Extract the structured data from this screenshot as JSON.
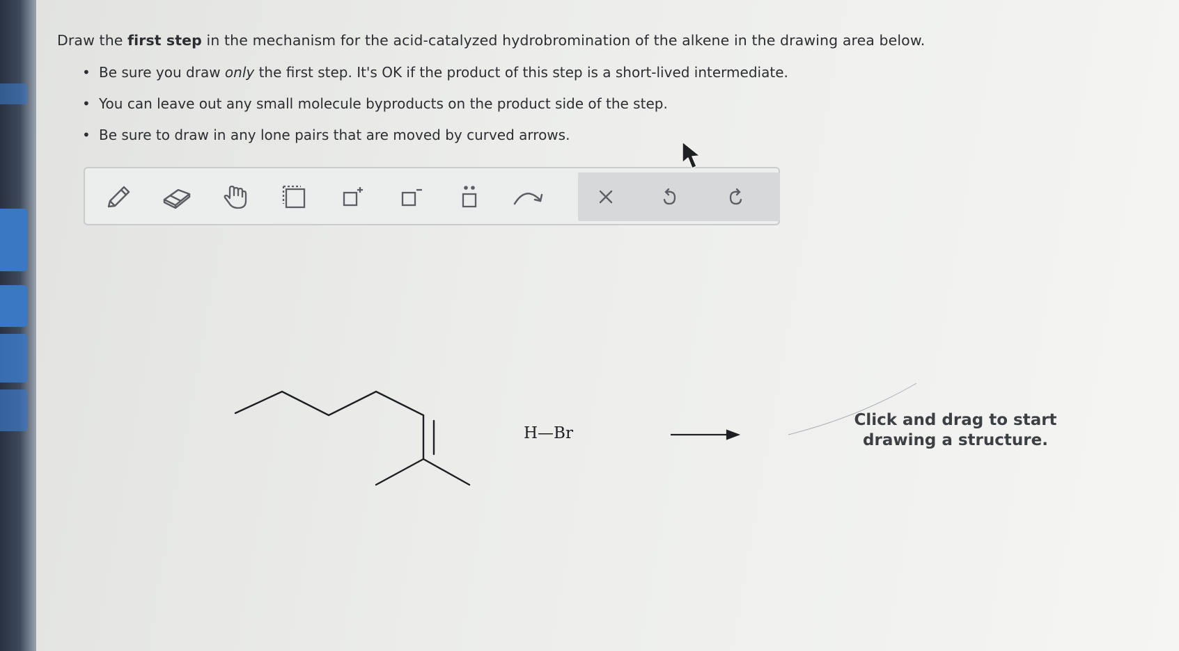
{
  "instructions": {
    "lead_before": "Draw the ",
    "lead_bold": "first step",
    "lead_after": " in the mechanism for the acid-catalyzed hydrobromination of the alkene in the drawing area below.",
    "bullet1_before": "Be sure you draw ",
    "bullet1_italic": "only",
    "bullet1_after": " the first step. It's OK if the product of this step is a short-lived intermediate.",
    "bullet2": "You can leave out any small molecule byproducts on the product side of the step.",
    "bullet3": "Be sure to draw in any lone pairs that are moved by curved arrows."
  },
  "toolbar": {
    "tools": [
      {
        "icon": "pencil-icon"
      },
      {
        "icon": "eraser-icon"
      },
      {
        "icon": "hand-icon"
      },
      {
        "icon": "select-box-icon"
      },
      {
        "icon": "positive-charge-icon"
      },
      {
        "icon": "negative-charge-icon"
      },
      {
        "icon": "lone-pair-icon"
      },
      {
        "icon": "curved-arrow-icon"
      },
      {
        "icon": "clear-icon"
      },
      {
        "icon": "undo-icon"
      },
      {
        "icon": "redo-icon"
      }
    ],
    "colors": {
      "icon": "#5a5e63",
      "group_bg": "#d6d8d9"
    }
  },
  "canvas": {
    "reagent": "H—Br",
    "hint_line1": "Click and drag to start",
    "hint_line2": "drawing a structure."
  }
}
